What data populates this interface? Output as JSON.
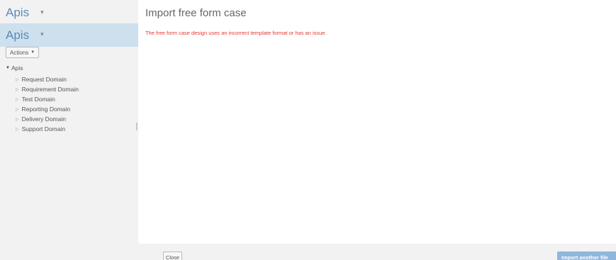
{
  "sidebar": {
    "project_selector_label": "Apis",
    "project_header_label": "Apis",
    "actions_label": "Actions",
    "tree": {
      "root_label": "Apis",
      "items": [
        {
          "label": "Request Domain"
        },
        {
          "label": "Requirement Domain"
        },
        {
          "label": "Test Domain"
        },
        {
          "label": "Reporting Domain"
        },
        {
          "label": "Delivery Domain"
        },
        {
          "label": "Support Domain"
        }
      ]
    }
  },
  "main": {
    "title": "Import free form case",
    "error_message": "The free form case design uses an incorrect template format or has an issue."
  },
  "footer": {
    "close_label": "Close",
    "import_another_label": "Import another file"
  },
  "colors": {
    "accent": "#5b8ab8",
    "header_bg": "#cde0ee",
    "error": "#e53935",
    "primary_button": "#8fb6dd"
  }
}
